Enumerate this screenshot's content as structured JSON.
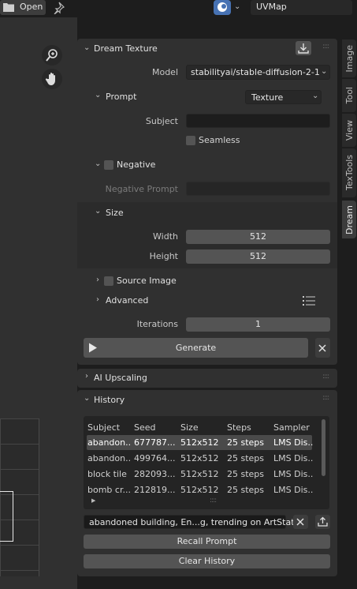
{
  "header": {
    "open_label": "Open",
    "uvmap_value": "UVMap"
  },
  "tabs": [
    "Image",
    "Tool",
    "View",
    "TexTools",
    "Dream"
  ],
  "dream_texture": {
    "title": "Dream Texture",
    "model_label": "Model",
    "model_value": "stabilityai/stable-diffusion-2-1",
    "prompt": {
      "title": "Prompt",
      "type_value": "Texture",
      "subject_label": "Subject",
      "subject_value": "",
      "seamless_label": "Seamless"
    },
    "negative": {
      "title": "Negative",
      "prompt_label": "Negative Prompt",
      "prompt_value": ""
    },
    "size": {
      "title": "Size",
      "width_label": "Width",
      "width_value": "512",
      "height_label": "Height",
      "height_value": "512"
    },
    "source_image": {
      "title": "Source Image"
    },
    "advanced": {
      "title": "Advanced"
    },
    "iterations_label": "Iterations",
    "iterations_value": "1",
    "generate_label": "Generate"
  },
  "ai_upscaling": {
    "title": "AI Upscaling"
  },
  "history": {
    "title": "History",
    "columns": [
      "Subject",
      "Seed",
      "Size",
      "Steps",
      "Sampler"
    ],
    "rows": [
      [
        "abandon...",
        "677787...",
        "512x512",
        "25 steps",
        "LMS Dis..."
      ],
      [
        "abandon...",
        "499764...",
        "512x512",
        "25 steps",
        "LMS Dis..."
      ],
      [
        "block tile",
        "282093...",
        "512x512",
        "25 steps",
        "LMS Dis..."
      ],
      [
        "bomb cr...",
        "212819...",
        "512x512",
        "25 steps",
        "LMS Dis..."
      ]
    ],
    "selected_prompt": "abandoned building, En...g, trending on ArtStation",
    "recall_label": "Recall Prompt",
    "clear_label": "Clear History"
  }
}
